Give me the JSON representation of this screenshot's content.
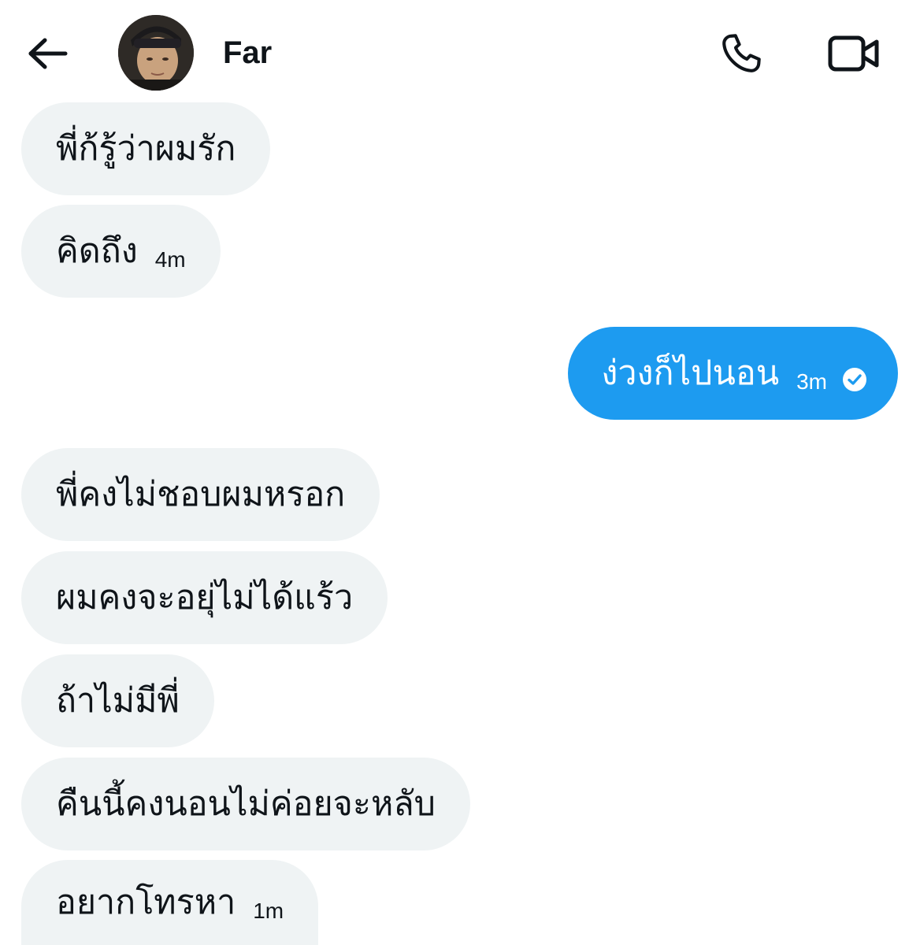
{
  "header": {
    "back_icon": "arrow-left-icon",
    "contact_name": "Far",
    "call_icon": "phone-icon",
    "video_icon": "video-camera-icon"
  },
  "messages": [
    {
      "direction": "incoming",
      "text": "พี่ก้รู้ว่าผมรัก",
      "time": ""
    },
    {
      "direction": "incoming",
      "text": "คิดถึง",
      "time": "4m"
    },
    {
      "direction": "outgoing",
      "text": "ง่วงก็ไปนอน",
      "time": "3m",
      "status_icon": "seen-check-icon"
    },
    {
      "direction": "incoming",
      "text": "พี่คงไม่ชอบผมหรอก",
      "time": ""
    },
    {
      "direction": "incoming",
      "text": "ผมคงจะอยุ่ไม่ได้แร้ว",
      "time": ""
    },
    {
      "direction": "incoming",
      "text": "ถ้าไม่มีพี่",
      "time": ""
    },
    {
      "direction": "incoming",
      "text": "คืนนี้คงนอนไม่ค่อยจะหลับ",
      "time": ""
    },
    {
      "direction": "incoming",
      "text": "อยากโทรหา",
      "time": "1m"
    }
  ],
  "colors": {
    "incoming_bubble": "#eff3f4",
    "outgoing_bubble": "#1d9bf0",
    "text": "#0f1419"
  }
}
